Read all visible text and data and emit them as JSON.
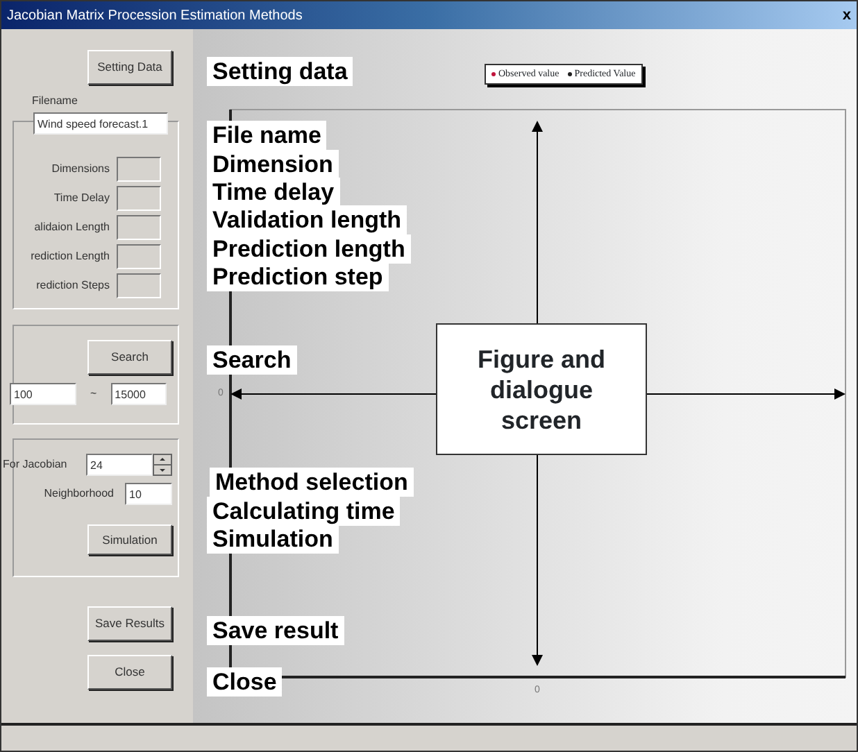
{
  "window": {
    "title": "Jacobian Matrix Procession Estimation Methods",
    "close": "x"
  },
  "setting_button": "Setting Data",
  "filename": {
    "label": "Filename",
    "value": "Wind speed forecast.1"
  },
  "parameters": [
    {
      "label": "Dimensions"
    },
    {
      "label": "Time Delay"
    },
    {
      "label": "alidaion Length"
    },
    {
      "label": "rediction Length"
    },
    {
      "label": "rediction Steps"
    }
  ],
  "search": {
    "button": "Search",
    "from": "100",
    "separator": "~",
    "to": "15000"
  },
  "method": {
    "jacobian_label": "For Jacobian",
    "jacobian_value": "24",
    "neighborhood_label": "Neighborhood",
    "neighborhood_value": "10",
    "button": "Simulation"
  },
  "buttons": [
    "Save Results",
    "Close"
  ],
  "plot": {
    "legend": [
      {
        "label": "Observed value",
        "color": "#c0143c"
      },
      {
        "label": "Predicted Value",
        "color": "#202020"
      }
    ],
    "y_zero": "0",
    "x_zero": "0"
  },
  "annotations": [
    "Setting data",
    "File name",
    "Dimension",
    "Time delay",
    "Validation length",
    "Prediction length",
    "Prediction step",
    "Search",
    "Method selection",
    "Calculating time",
    "Simulation",
    "Save result",
    "Close"
  ],
  "callout": "Figure and dialogue screen"
}
